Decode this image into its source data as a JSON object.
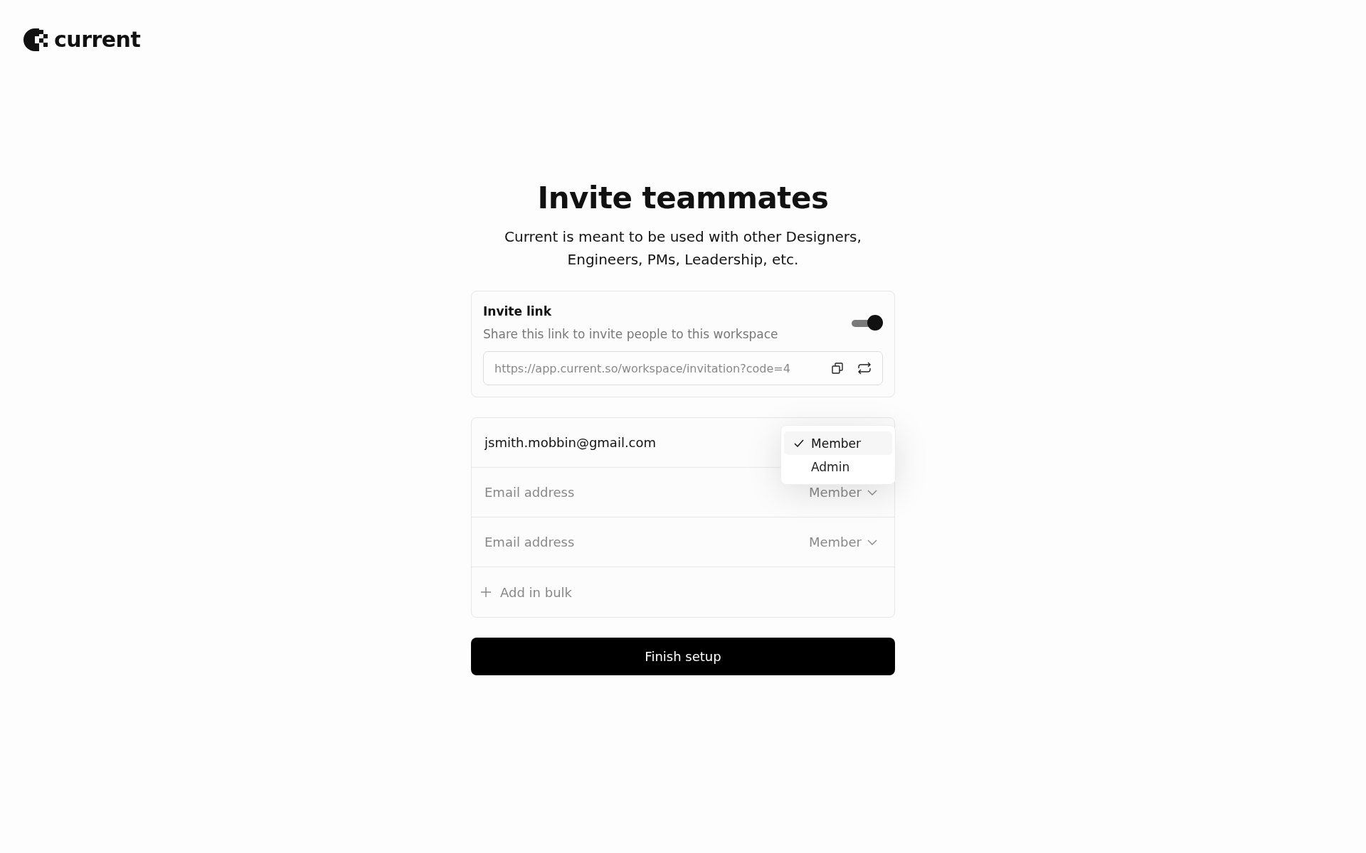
{
  "brand": {
    "name": "current"
  },
  "heading": "Invite teammates",
  "subtitle": "Current is meant to be used with other Designers, Engineers, PMs, Leadership, etc.",
  "invite_link": {
    "title": "Invite link",
    "description": "Share this link to invite people to this workspace",
    "on": true,
    "url": "https://app.current.so/workspace/invitation?code=4"
  },
  "invites": [
    {
      "value": "jsmith.mobbin@gmail.com",
      "menu": [
        {
          "label": "Member",
          "selected": true
        },
        {
          "label": "Admin",
          "selected": false
        }
      ]
    },
    {
      "placeholder": "Email address",
      "role": "Member"
    },
    {
      "placeholder": "Email address",
      "role": "Member"
    }
  ],
  "add_bulk": "Add in bulk",
  "finish_button": "Finish setup"
}
